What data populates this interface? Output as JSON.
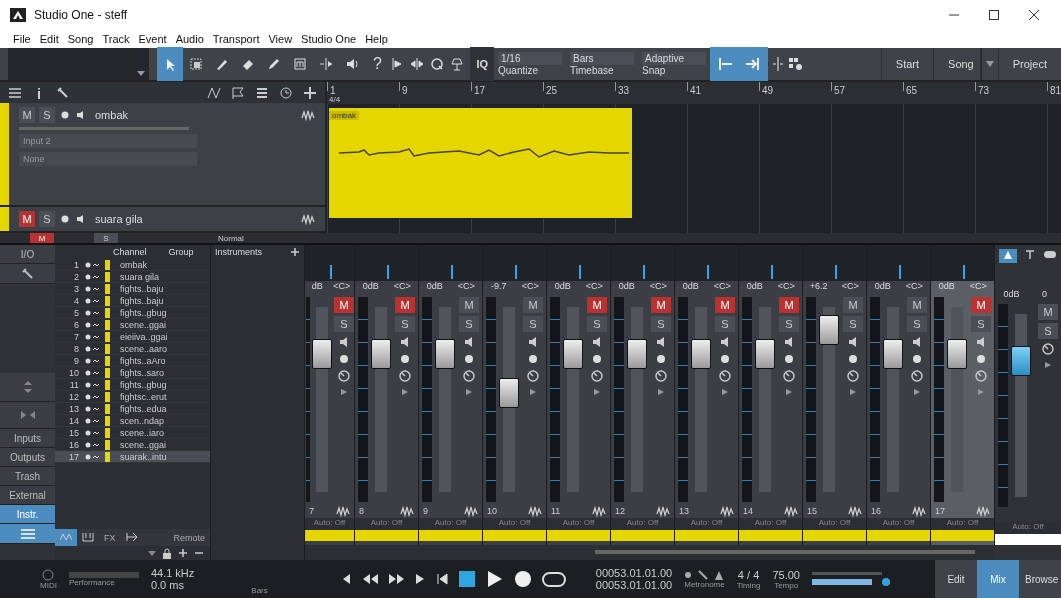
{
  "window": {
    "title": "Studio One - steff"
  },
  "menu": [
    "File",
    "Edit",
    "Song",
    "Track",
    "Event",
    "Audio",
    "Transport",
    "View",
    "Studio One",
    "Help"
  ],
  "toolbar": {
    "help": "?",
    "iq": "IQ",
    "tools": [
      {
        "selected": true
      },
      {
        "selected": false
      },
      {
        "selected": false
      },
      {
        "selected": false
      },
      {
        "selected": false
      },
      {
        "selected": false
      },
      {
        "selected": false
      },
      {
        "selected": false
      }
    ],
    "selectors": [
      {
        "value": "1/16",
        "label": "Quantize"
      },
      {
        "value": "Bars",
        "label": "Timebase"
      },
      {
        "value": "Adaptive",
        "label": "Snap"
      }
    ],
    "pages": [
      {
        "label": "Start",
        "dropdown": false
      },
      {
        "label": "Song",
        "dropdown": true
      },
      {
        "label": "Project",
        "dropdown": false
      }
    ]
  },
  "arrange": {
    "ruler": [
      "1",
      "9",
      "17",
      "25",
      "33",
      "41",
      "49",
      "57",
      "65",
      "73",
      "81"
    ],
    "time_signature": "4/4",
    "tracks": [
      {
        "name": "ombak",
        "buttons": [
          {
            "label": "M",
            "on": false
          },
          {
            "label": "S",
            "on": false
          }
        ],
        "input": "Input 2",
        "output": "None"
      },
      {
        "name": "suara gila",
        "buttons": [
          {
            "label": "M",
            "on": true
          },
          {
            "label": "S",
            "on": false
          }
        ]
      }
    ],
    "clip": {
      "name": "ombak"
    },
    "footer": {
      "buttons": [
        {
          "label": "M",
          "on": true
        },
        {
          "label": "S",
          "on": false
        }
      ],
      "mode": "Normal"
    }
  },
  "mixer": {
    "nav": [
      {
        "label": "I/O",
        "selected": false
      },
      {
        "label": "Inputs",
        "selected": false
      },
      {
        "label": "Outputs",
        "selected": false
      },
      {
        "label": "Trash",
        "selected": false
      },
      {
        "label": "External",
        "selected": false
      },
      {
        "label": "Instr.",
        "selected": true
      }
    ],
    "view_toggle": {
      "selected": true
    },
    "columns": [
      "Channel",
      "Group"
    ],
    "instruments": "Instruments",
    "channels": [
      {
        "number": "1",
        "name": "ombak",
        "selected": false
      },
      {
        "number": "2",
        "name": "suara gila",
        "selected": false
      },
      {
        "number": "3",
        "name": "fights..baju",
        "selected": false
      },
      {
        "number": "4",
        "name": "fights..baju",
        "selected": false
      },
      {
        "number": "5",
        "name": "fights..gbug",
        "selected": false
      },
      {
        "number": "6",
        "name": "scene..ggai",
        "selected": false
      },
      {
        "number": "7",
        "name": "eieiiva..ggai",
        "selected": false
      },
      {
        "number": "8",
        "name": "scene..aaro",
        "selected": false
      },
      {
        "number": "9",
        "name": "fights..aAro",
        "selected": false
      },
      {
        "number": "10",
        "name": "fights..saro",
        "selected": false
      },
      {
        "number": "11",
        "name": "fights..gbug",
        "selected": false
      },
      {
        "number": "12",
        "name": "fightsc..erut",
        "selected": false
      },
      {
        "number": "13",
        "name": "fights..edua",
        "selected": false
      },
      {
        "number": "14",
        "name": "scen..ndap",
        "selected": false
      },
      {
        "number": "15",
        "name": "scene..iaro",
        "selected": false
      },
      {
        "number": "16",
        "name": "scene..ggai",
        "selected": false
      },
      {
        "number": "17",
        "name": "suarak..intu",
        "selected": true
      }
    ],
    "list_tabs": [
      {
        "kind": "icon",
        "selected": true
      },
      {
        "kind": "icon",
        "selected": false
      },
      {
        "kind": "text",
        "label": "FX",
        "selected": false
      },
      {
        "kind": "icon",
        "selected": false
      },
      {
        "kind": "text",
        "label": "Remote",
        "selected": false
      }
    ],
    "strips": [
      {
        "number": "7",
        "volume": "dB",
        "pan": "<C>",
        "level": 0.79,
        "buttons": [
          {
            "label": "M",
            "on": true
          },
          {
            "label": "S",
            "on": false
          }
        ],
        "automation": "Auto: Off",
        "color": "#e6d600",
        "selected": false
      },
      {
        "number": "8",
        "volume": "0dB",
        "pan": "<C>",
        "level": 0.79,
        "buttons": [
          {
            "label": "M",
            "on": true
          },
          {
            "label": "S",
            "on": false
          }
        ],
        "automation": "Auto: Off",
        "color": "#e6d600",
        "selected": false
      },
      {
        "number": "9",
        "volume": "0dB",
        "pan": "<C>",
        "level": 0.79,
        "buttons": [
          {
            "label": "M",
            "on": false
          },
          {
            "label": "S",
            "on": false
          }
        ],
        "automation": "Auto: Off",
        "color": "#e6d600",
        "selected": false
      },
      {
        "number": "10",
        "volume": "-9.7",
        "pan": "<C>",
        "level": 0.53,
        "buttons": [
          {
            "label": "M",
            "on": false
          },
          {
            "label": "S",
            "on": false
          }
        ],
        "automation": "Auto: Off",
        "color": "#e6d600",
        "selected": false
      },
      {
        "number": "11",
        "volume": "0dB",
        "pan": "<C>",
        "level": 0.79,
        "buttons": [
          {
            "label": "M",
            "on": true
          },
          {
            "label": "S",
            "on": false
          }
        ],
        "automation": "Auto: Off",
        "color": "#e6d600",
        "selected": false
      },
      {
        "number": "12",
        "volume": "0dB",
        "pan": "<C>",
        "level": 0.79,
        "buttons": [
          {
            "label": "M",
            "on": true
          },
          {
            "label": "S",
            "on": false
          }
        ],
        "automation": "Auto: Off",
        "color": "#e6d600",
        "selected": false
      },
      {
        "number": "13",
        "volume": "0dB",
        "pan": "<C>",
        "level": 0.79,
        "buttons": [
          {
            "label": "M",
            "on": true
          },
          {
            "label": "S",
            "on": false
          }
        ],
        "automation": "Auto: Off",
        "color": "#e6d600",
        "selected": false
      },
      {
        "number": "14",
        "volume": "0dB",
        "pan": "<C>",
        "level": 0.79,
        "buttons": [
          {
            "label": "M",
            "on": true
          },
          {
            "label": "S",
            "on": false
          }
        ],
        "automation": "Auto: Off",
        "color": "#e6d600",
        "selected": false
      },
      {
        "number": "15",
        "volume": "+6.2",
        "pan": "<C>",
        "level": 0.95,
        "buttons": [
          {
            "label": "M",
            "on": false
          },
          {
            "label": "S",
            "on": false
          }
        ],
        "automation": "Auto: Off",
        "color": "#e6d600",
        "selected": false
      },
      {
        "number": "16",
        "volume": "0dB",
        "pan": "<C>",
        "level": 0.79,
        "buttons": [
          {
            "label": "M",
            "on": false
          },
          {
            "label": "S",
            "on": false
          }
        ],
        "automation": "Auto: Off",
        "color": "#e6d600",
        "selected": false
      },
      {
        "number": "17",
        "volume": "0dB",
        "pan": "<C>",
        "level": 0.79,
        "buttons": [
          {
            "label": "M",
            "on": true
          },
          {
            "label": "S",
            "on": false
          }
        ],
        "automation": "Auto: Off",
        "color": "#e6d600",
        "selected": true
      }
    ],
    "main": {
      "volume": "0dB",
      "peak": "0",
      "level": 0.79,
      "buttons": [
        {
          "label": "M",
          "on": false
        },
        {
          "label": "S",
          "on": false
        }
      ],
      "automation": "Auto: Off",
      "color": "#ffffff"
    }
  },
  "transport": {
    "sample_rate": "44.1 kHz",
    "performance_label": "Performance",
    "latency": "0.0 ms",
    "midi_label": "MIDI",
    "bars_label": "Bars",
    "positions": [
      "00053.01.01.00",
      "00053.01.01.00"
    ],
    "metronome_label": "Metronome",
    "signature": "4 / 4",
    "timing_label": "Timing",
    "tempo": "75.00",
    "tempo_label": "Tempo",
    "views": [
      {
        "label": "Edit",
        "selected": false
      },
      {
        "label": "Mix",
        "selected": true
      },
      {
        "label": "Browse",
        "selected": false
      }
    ]
  }
}
